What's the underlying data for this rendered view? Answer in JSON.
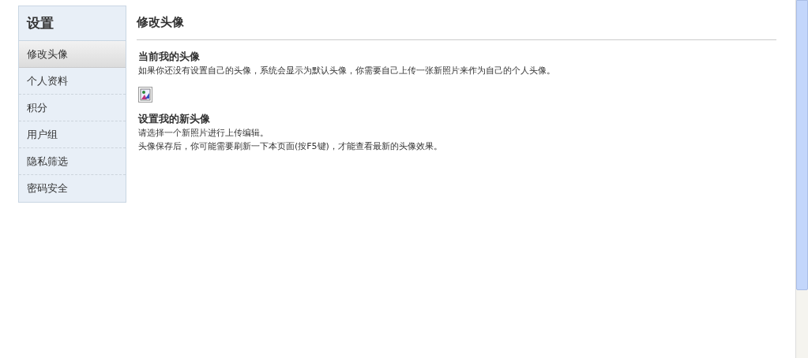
{
  "sidebar": {
    "title": "设置",
    "items": [
      {
        "label": "修改头像",
        "selected": true
      },
      {
        "label": "个人资料",
        "selected": false
      },
      {
        "label": "积分",
        "selected": false
      },
      {
        "label": "用户组",
        "selected": false
      },
      {
        "label": "隐私筛选",
        "selected": false
      },
      {
        "label": "密码安全",
        "selected": false
      }
    ]
  },
  "main": {
    "title": "修改头像",
    "sections": [
      {
        "heading": "当前我的头像",
        "lines": [
          "如果你还没有设置自己的头像，系统会显示为默认头像，你需要自己上传一张新照片来作为自己的个人头像。"
        ],
        "kind": "avatar"
      },
      {
        "heading": "设置我的新头像",
        "lines": [
          "请选择一个新照片进行上传编辑。",
          "头像保存后，你可能需要刷新一下本页面(按F5键)，才能查看最新的头像效果。"
        ],
        "kind": "text"
      }
    ]
  }
}
